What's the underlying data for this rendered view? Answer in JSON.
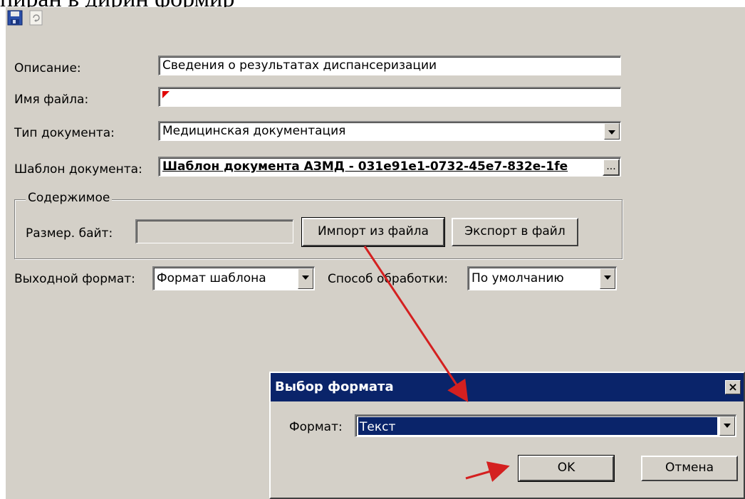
{
  "caption_fragment": "пиран в дирин формир",
  "toolbar": {
    "save_icon": "save-icon",
    "refresh_icon": "refresh-icon"
  },
  "form": {
    "description_label": "Описание:",
    "description_value": "Сведения о результатах диспансеризации",
    "filename_label": "Имя файла:",
    "filename_value": "",
    "doctype_label": "Тип документа:",
    "doctype_value": "Медицинская документация",
    "template_label": "Шаблон документа:",
    "template_value": "Шаблон документа АЗМД - 031e91e1-0732-45e7-832e-1fe",
    "template_browse": "...",
    "content_group": "Содержимое",
    "size_label": "Размер. байт:",
    "size_value": "",
    "import_button": "Импорт из файла",
    "export_button": "Экспорт в файл",
    "output_format_label": "Выходной формат:",
    "output_format_value": "Формат шаблона",
    "processing_label": "Способ обработки:",
    "processing_value": "По умолчанию"
  },
  "dialog": {
    "title": "Выбор формата",
    "close": "×",
    "format_label": "Формат:",
    "format_value": "Текст",
    "ok_button": "OK",
    "cancel_button": "Отмена"
  },
  "colors": {
    "panel": "#d4d0c8",
    "titlebar": "#0a246a",
    "arrow": "#d42020"
  }
}
